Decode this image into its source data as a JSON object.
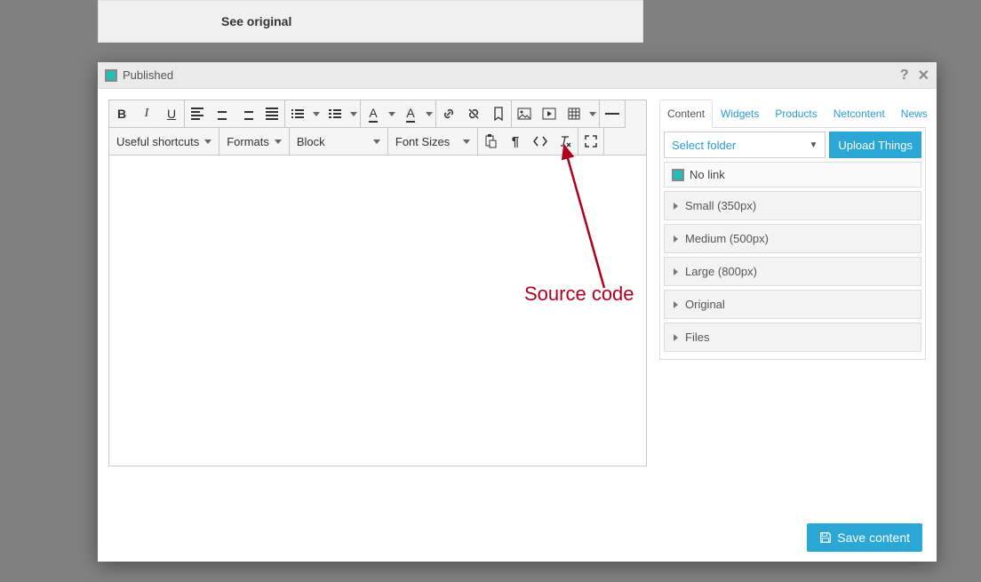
{
  "background": {
    "see_original": "See original"
  },
  "modal": {
    "published": "Published",
    "save": "Save content"
  },
  "toolbar": {
    "useful_shortcuts": "Useful shortcuts",
    "formats": "Formats",
    "block": "Block",
    "font_sizes": "Font Sizes"
  },
  "side": {
    "tabs": {
      "content": "Content",
      "widgets": "Widgets",
      "products": "Products",
      "netcontent": "Netcontent",
      "news": "News"
    },
    "select_folder": "Select folder",
    "upload": "Upload Things",
    "no_link": "No link",
    "items": [
      {
        "label": "Small (350px)"
      },
      {
        "label": "Medium (500px)"
      },
      {
        "label": "Large (800px)"
      },
      {
        "label": "Original"
      },
      {
        "label": "Files"
      }
    ]
  },
  "annotation": {
    "label": "Source code"
  }
}
